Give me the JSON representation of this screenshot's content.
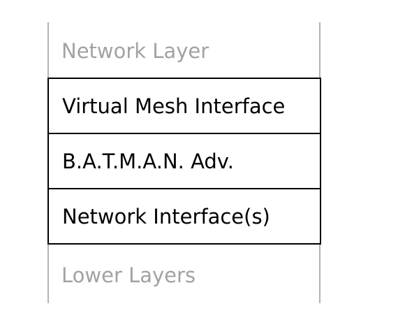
{
  "diagram": {
    "top_label": "Network Layer",
    "layers": [
      {
        "label": "Virtual Mesh Interface"
      },
      {
        "label": "B.A.T.M.A.N. Adv."
      },
      {
        "label": "Network Interface(s)"
      }
    ],
    "bottom_label": "Lower Layers",
    "colors": {
      "box_border": "#000000",
      "side_lines": "#b3b3b3",
      "soft_text": "#a2a2a2"
    }
  }
}
